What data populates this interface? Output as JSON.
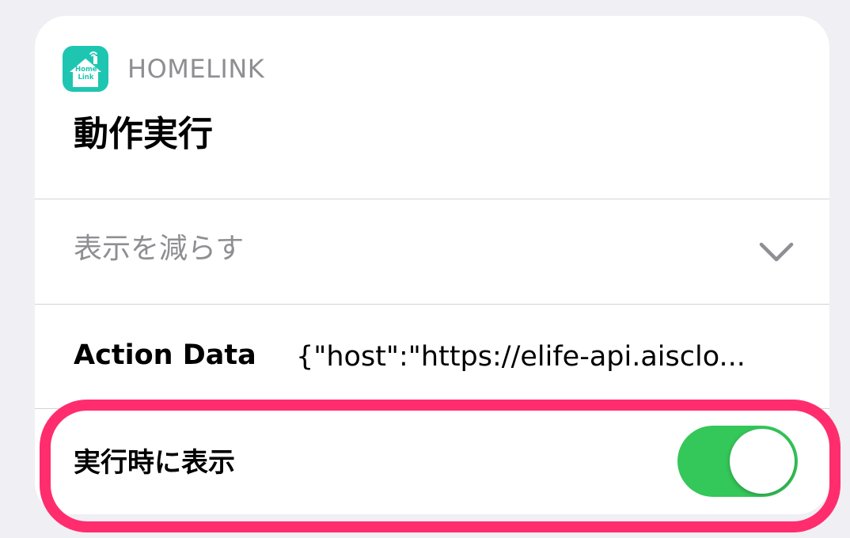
{
  "app": {
    "name": "HOMELINK",
    "icon_name": "homelink-app-icon",
    "icon_text_line1": "Home",
    "icon_text_line2": "Link",
    "icon_color": "#1ec6b2"
  },
  "action": {
    "title": "動作実行"
  },
  "show_less": {
    "label": "表示を減らす",
    "icon_name": "chevron-down-icon"
  },
  "parameters": [
    {
      "label": "Action Data",
      "value": "{\"host\":\"https://elife-api.aisclo..."
    }
  ],
  "show_when_run": {
    "label": "実行時に表示",
    "enabled": true,
    "on_color": "#34c759"
  },
  "highlight": {
    "color": "#ff2d6e"
  }
}
